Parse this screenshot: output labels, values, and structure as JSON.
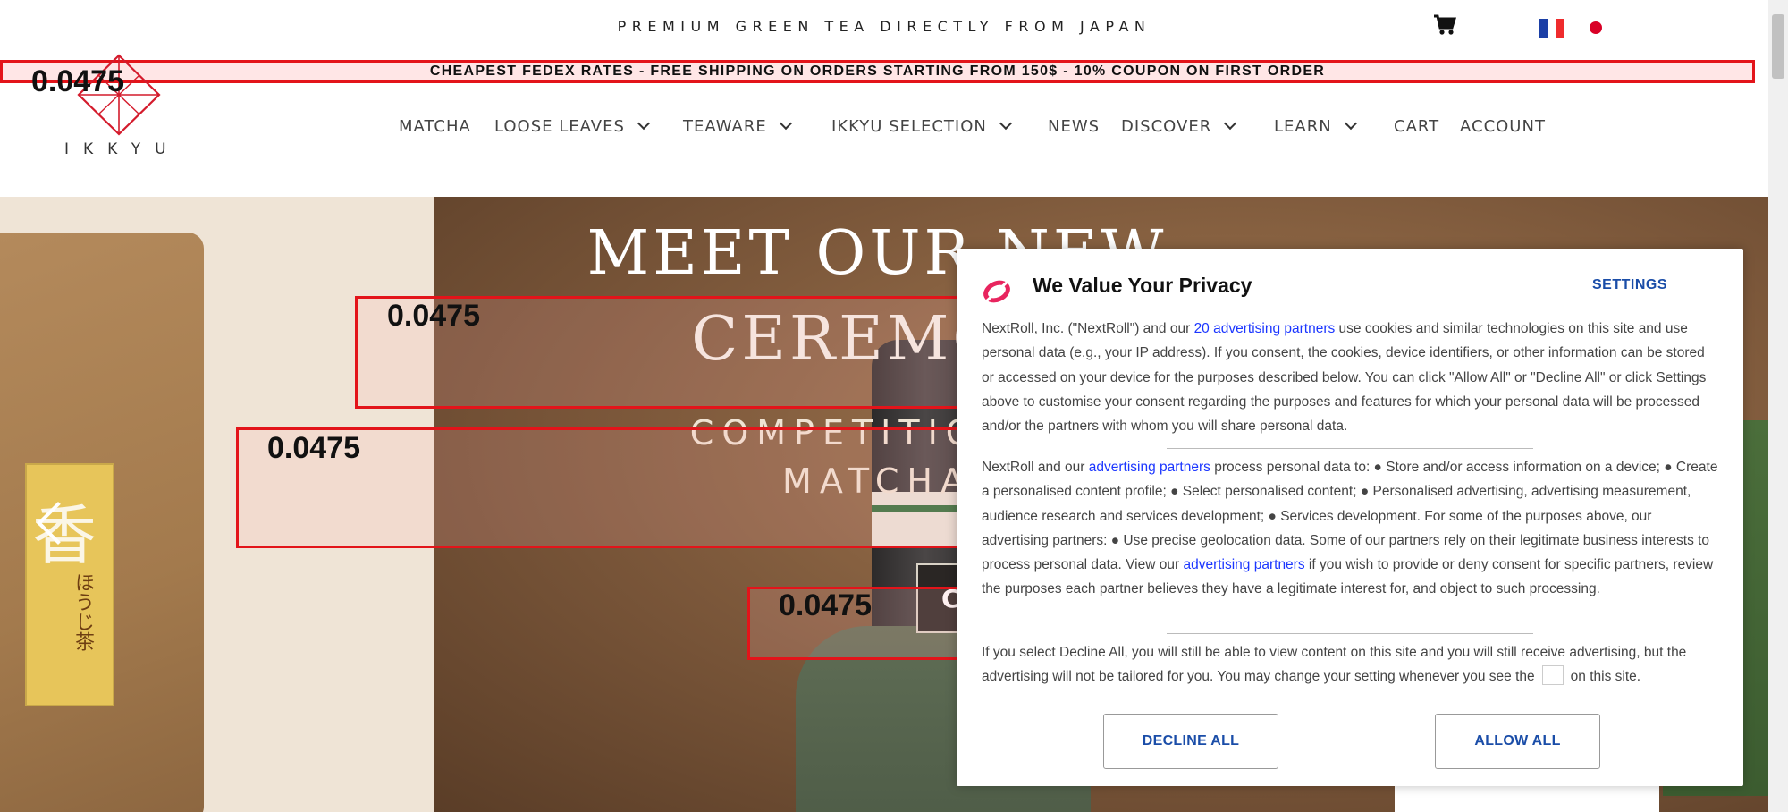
{
  "top": {
    "tagline": "PREMIUM GREEN TEA DIRECTLY FROM JAPAN",
    "promo": "CHEAPEST FEDEX RATES - FREE SHIPPING ON ORDERS STARTING FROM 150$ - 10% COUPON ON FIRST ORDER"
  },
  "header": {
    "logo_text": "IKKYU",
    "nav": [
      {
        "label": "MATCHA"
      },
      {
        "label": "LOOSE LEAVES"
      },
      {
        "label": "TEAWARE"
      },
      {
        "label": "IKKYU SELECTION"
      },
      {
        "label": "NEWS"
      },
      {
        "label": "DISCOVER"
      },
      {
        "label": "LEARN"
      },
      {
        "label": "CART"
      },
      {
        "label": "ACCOUNT"
      }
    ]
  },
  "overlay_scores": [
    "0.0475",
    "0.0475",
    "0.0475",
    "0.0475"
  ],
  "hero": {
    "title_line1": "MEET OUR NEW",
    "title_line2": "CEREMON",
    "sub_line1": "COMPETITION A",
    "sub_line2": "MATCHA",
    "button_label": "C",
    "tea_kanji": "香",
    "tea_small": "ほうじ茶"
  },
  "privacy": {
    "title": "We Value Your Privacy",
    "settings": "SETTINGS",
    "p1_a": "NextRoll, Inc. (\"NextRoll\") and our ",
    "p1_link": "20 advertising partners",
    "p1_b": " use cookies and similar technologies on this site and use personal data (e.g., your IP address). If you consent, the cookies, device identifiers, or other information can be stored or accessed on your device for the purposes described below. You can click \"Allow All\" or \"Decline All\" or click Settings above to customise your consent regarding the purposes and features for which your personal data will be processed and/or the partners with whom you will share personal data.",
    "p2_a": "NextRoll and our ",
    "p2_link": "advertising partners",
    "p2_b": " process personal data to: ● Store and/or access information on a device; ● Create a personalised content profile; ● Select personalised content; ● Personalised advertising, advertising measurement, audience research and services development; ● Services development. For some of the purposes above, our advertising partners: ● Use precise geolocation data. Some of our partners rely on their legitimate business interests to process personal data. View our ",
    "p2_link2": "advertising partners",
    "p2_c": " if you wish to provide or deny consent for specific partners, review the purposes each partner believes they have a legitimate interest for, and object to such processing.",
    "p3_a": "If you select Decline All, you will still be able to view content on this site and you will still receive advertising, but the advertising will not be tailored for you. You may change your setting whenever you see the",
    "p3_b": "on this site.",
    "decline": "DECLINE ALL",
    "allow": "ALLOW ALL"
  },
  "colors": {
    "accent_red": "#e3141a",
    "link_blue": "#1b36ff",
    "button_blue": "#1a4da8",
    "flag_fr_blue": "#1b3fa6",
    "flag_fr_red": "#ef2b2d",
    "flag_jp_red": "#d90026"
  },
  "icons": [
    "cart-icon",
    "flag-fr-icon",
    "flag-jp-icon",
    "ikkyu-logo-icon",
    "chevron-down-icon",
    "chevron-left-icon",
    "nextroll-logo-icon"
  ]
}
